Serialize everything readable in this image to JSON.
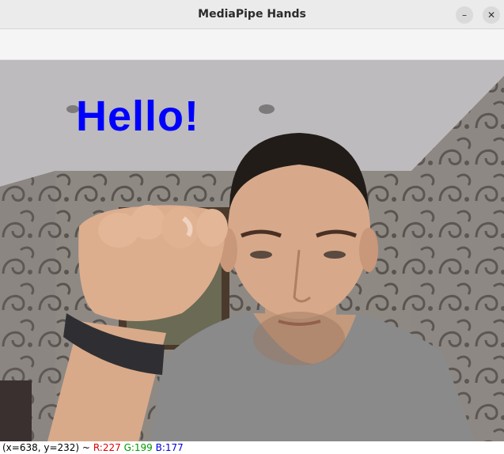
{
  "window": {
    "title": "MediaPipe Hands",
    "minimize_symbol": "–",
    "close_symbol": "✕"
  },
  "viewport": {
    "overlay_text": "Hello!",
    "overlay_color": "#0000ff"
  },
  "status": {
    "coords": "(x=638, y=232) ~",
    "r": "R:227",
    "g": "G:199",
    "b": "B:177"
  }
}
